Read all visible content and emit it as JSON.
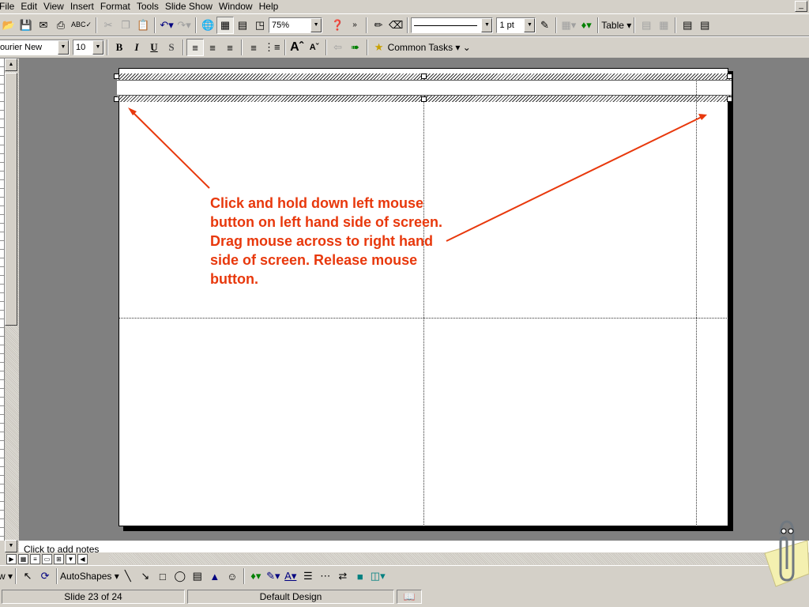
{
  "menubar": {
    "items": [
      "File",
      "Edit",
      "View",
      "Insert",
      "Format",
      "Tools",
      "Slide Show",
      "Window",
      "Help"
    ]
  },
  "toolbar_standard": {
    "zoom_value": "75%",
    "line_weight": "1 pt",
    "table_label": "Table"
  },
  "toolbar_formatting": {
    "font_name": "Courier New",
    "font_size": "10",
    "bold_label": "B",
    "italic_label": "I",
    "underline_label": "U",
    "shadow_label": "S",
    "common_tasks_label": "Common Tasks"
  },
  "slide": {
    "callout_text": "Click and hold down left mouse button on left hand side of screen.  Drag mouse across to right hand side of screen.  Release mouse button.",
    "callout_color": "#e8380c"
  },
  "notes": {
    "placeholder": "Click to add notes"
  },
  "drawing_toolbar": {
    "autoshapes_label": "AutoShapes"
  },
  "statusbar": {
    "slide_position": "Slide 23 of 24",
    "design_name": "Default Design"
  },
  "icons": [
    "open-icon",
    "save-icon",
    "print-icon",
    "spelling-icon",
    "cut-icon",
    "copy-icon",
    "paste-icon",
    "undo-icon",
    "redo-icon",
    "hyperlink-icon",
    "tables-and-borders-icon",
    "insert-table-icon",
    "insert-chart-icon",
    "help-icon",
    "pen-icon",
    "eraser-icon",
    "pencil-icon",
    "fill-color-icon",
    "select-pointer-icon",
    "free-rotate-icon",
    "line-icon",
    "arrow-icon",
    "rectangle-icon",
    "oval-icon",
    "text-box-icon",
    "wordart-icon",
    "clip-art-icon",
    "line-color-icon",
    "font-color-icon",
    "line-style-icon",
    "dash-style-icon",
    "arrow-style-icon",
    "shadow-icon",
    "3d-icon",
    "office-assistant-icon"
  ]
}
